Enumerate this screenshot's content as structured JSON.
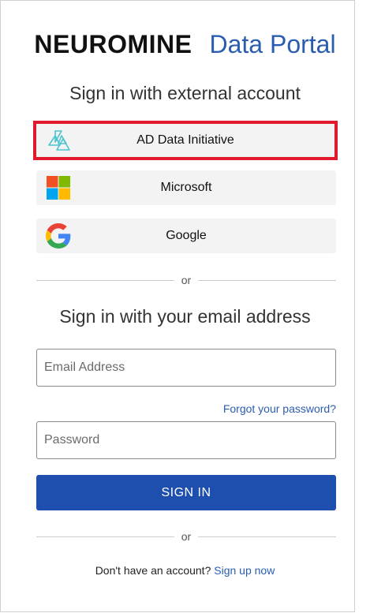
{
  "brand": {
    "name": "NEUROMINE",
    "product": "Data Portal"
  },
  "external": {
    "title": "Sign in with external account",
    "providers": [
      {
        "label": "AD Data Initiative",
        "icon": "ad-data-initiative-logo-icon"
      },
      {
        "label": "Microsoft",
        "icon": "microsoft-logo-icon"
      },
      {
        "label": "Google",
        "icon": "google-logo-icon"
      }
    ]
  },
  "divider_text": "or",
  "email_section": {
    "title": "Sign in with your email address",
    "email_placeholder": "Email Address",
    "password_placeholder": "Password",
    "forgot_label": "Forgot your password?",
    "submit_label": "SIGN IN"
  },
  "signup": {
    "prompt": "Don't have an account?",
    "link_label": "Sign up now"
  },
  "colors": {
    "accent": "#1f4fae",
    "link": "#2a5db0",
    "highlight": "#e0192c"
  }
}
